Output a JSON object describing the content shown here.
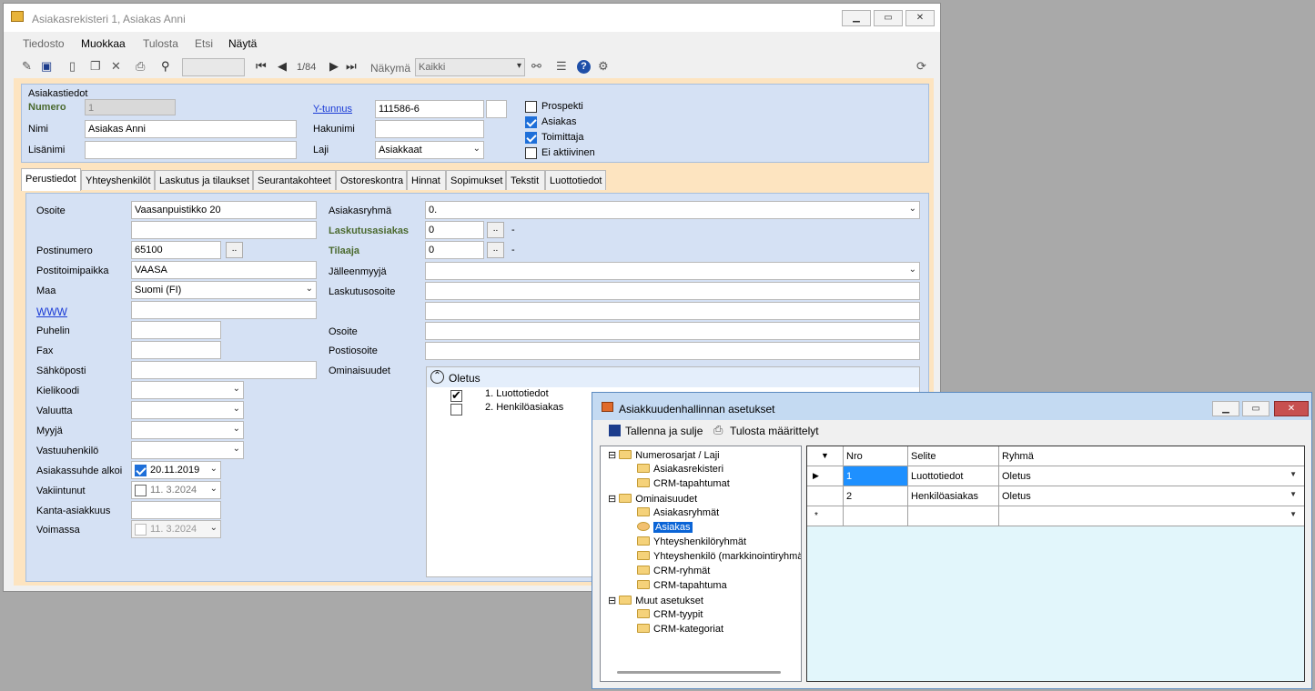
{
  "main_window": {
    "title": "Asiakasrekisteri 1, Asiakas Anni",
    "menu": [
      "Tiedosto",
      "Muokkaa",
      "Tulosta",
      "Etsi",
      "Näytä"
    ],
    "toolbar": {
      "record_pos": "1/84",
      "view_label": "Näkymä",
      "view_value": "Kaikki"
    },
    "customer": {
      "section_label": "Asiakastiedot",
      "numero_label": "Numero",
      "numero_value": "1",
      "nimi_label": "Nimi",
      "nimi_value": "Asiakas Anni",
      "lisanimi_label": "Lisänimi",
      "lisanimi_value": "",
      "ytunnus_label": "Y-tunnus",
      "ytunnus_value": "111586-6",
      "hakunimi_label": "Hakunimi",
      "hakunimi_value": "",
      "laji_label": "Laji",
      "laji_value": "Asiakkaat",
      "checks": [
        {
          "label": "Prospekti",
          "checked": false
        },
        {
          "label": "Asiakas",
          "checked": true
        },
        {
          "label": "Toimittaja",
          "checked": true
        },
        {
          "label": "Ei aktiivinen",
          "checked": false
        }
      ]
    },
    "tabs": [
      "Perustiedot",
      "Yhteyshenkilöt",
      "Laskutus ja tilaukset",
      "Seurantakohteet",
      "Ostoreskontra",
      "Hinnat",
      "Sopimukset",
      "Tekstit",
      "Luottotiedot"
    ],
    "left": {
      "osoite_label": "Osoite",
      "osoite_value": "Vaasanpuistikko 20",
      "osoite2_value": "",
      "postinumero_label": "Postinumero",
      "postinumero_value": "65100",
      "postitoimipaikka_label": "Postitoimipaikka",
      "postitoimipaikka_value": "VAASA",
      "maa_label": "Maa",
      "maa_value": "Suomi (FI)",
      "www_label": "WWW",
      "puhelin_label": "Puhelin",
      "fax_label": "Fax",
      "sahkoposti_label": "Sähköposti",
      "kielikoodi_label": "Kielikoodi",
      "valuutta_label": "Valuutta",
      "myyja_label": "Myyjä",
      "vastuuhenkilo_label": "Vastuuhenkilö",
      "asiakassuhde_label": "Asiakassuhde alkoi",
      "asiakassuhde_value": "20.11.2019",
      "vakiintunut_label": "Vakiintunut",
      "vakiintunut_value": "11.  3.2024",
      "kanta_label": "Kanta-asiakkuus",
      "voimassa_label": "Voimassa",
      "voimassa_value": "11.  3.2024",
      "browse_btn": ".."
    },
    "right": {
      "asiakasryhma_label": "Asiakasryhmä",
      "asiakasryhma_value": "0.",
      "laskutusasiakas_label": "Laskutusasiakas",
      "laskutusasiakas_value": "0",
      "tilaaja_label": "Tilaaja",
      "tilaaja_value": "0",
      "dash": "-",
      "jalleenmyyja_label": "Jälleenmyyjä",
      "laskutusosoite_label": "Laskutusosoite",
      "osoite_label": "Osoite",
      "postiosoite_label": "Postiosoite",
      "ominaisuudet_label": "Ominaisuudet",
      "group_title": "Oletus",
      "props": [
        {
          "label": "1. Luottotiedot",
          "checked": true
        },
        {
          "label": "2. Henkilöasiakas",
          "checked": false
        }
      ]
    }
  },
  "settings_window": {
    "title": "Asiakkuudenhallinnan asetukset",
    "save_label": "Tallenna ja sulje",
    "print_label": "Tulosta määrittelyt",
    "tree": [
      {
        "label": "Numerosarjat / Laji",
        "level": 0
      },
      {
        "label": "Asiakasrekisteri",
        "level": 1
      },
      {
        "label": "CRM-tapahtumat",
        "level": 1
      },
      {
        "label": "Ominaisuudet",
        "level": 0
      },
      {
        "label": "Asiakasryhmät",
        "level": 1
      },
      {
        "label": "Asiakas",
        "level": 1,
        "selected": true
      },
      {
        "label": "Yhteyshenkilöryhmät",
        "level": 1
      },
      {
        "label": "Yhteyshenkilö (markkinointiryhmät",
        "level": 1
      },
      {
        "label": "CRM-ryhmät",
        "level": 1
      },
      {
        "label": "CRM-tapahtuma",
        "level": 1
      },
      {
        "label": "Muut asetukset",
        "level": 0
      },
      {
        "label": "CRM-tyypit",
        "level": 1
      },
      {
        "label": "CRM-kategoriat",
        "level": 1
      }
    ],
    "grid_headers": [
      "Nro",
      "Selite",
      "Ryhmä"
    ],
    "rows": [
      {
        "nro": "1",
        "selite": "Luottotiedot",
        "ryhma": "Oletus"
      },
      {
        "nro": "2",
        "selite": "Henkilöasiakas",
        "ryhma": "Oletus"
      }
    ]
  }
}
